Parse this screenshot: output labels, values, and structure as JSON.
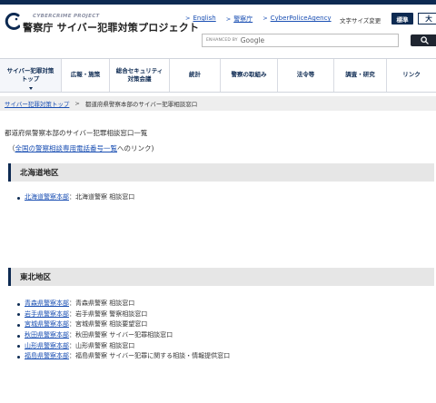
{
  "header": {
    "logo_sub": "CYBERCRIME PROJECT",
    "logo_main": "警察庁 サイバー犯罪対策プロジェクト",
    "top_links": [
      "English",
      "警察庁",
      "CyberPoliceAgency"
    ],
    "font_size_label": "文字サイズ変更",
    "font_std": "標準",
    "font_large": "大",
    "search_enhanced": "ENHANCED BY",
    "search_google": "Google"
  },
  "nav": [
    "サイバー犯罪対策\nトップ",
    "広報・施策",
    "総合セキュリティ\n対策会議",
    "統計",
    "警察の取組み",
    "法令等",
    "調査・研究",
    "リンク"
  ],
  "breadcrumb": {
    "home": "サイバー犯罪対策トップ",
    "sep": ">",
    "current": "都道府県警察本部のサイバー犯罪相談窓口"
  },
  "main": {
    "heading": "都道府県警察本部のサイバー犯罪相談窓口一覧",
    "national_prefix": "（",
    "national_link": "全国の警察相談専用電話番号一覧",
    "national_suffix": "へのリンク)"
  },
  "regions": [
    {
      "name": "北海道地区",
      "items": [
        {
          "link": "北海道警察本部",
          "desc": "：北海道警察 相談窓口"
        }
      ]
    },
    {
      "name": "東北地区",
      "items": [
        {
          "link": "青森県警察本部",
          "desc": "：青森県警察 相談窓口"
        },
        {
          "link": "岩手県警察本部",
          "desc": "：岩手県警察 警察相談窓口"
        },
        {
          "link": "宮城県警察本部",
          "desc": "：宮城県警察 相談要望窓口"
        },
        {
          "link": "秋田県警察本部",
          "desc": "：秋田県警察 サイバー犯罪相談窓口"
        },
        {
          "link": "山形県警察本部",
          "desc": "：山形県警察 相談窓口"
        },
        {
          "link": "福島県警察本部",
          "desc": "：福島県警察 サイバー犯罪に関する相談・情報提供窓口"
        }
      ]
    }
  ],
  "colors": {
    "navy": "#0d2a52",
    "link": "#1a4fb3",
    "band": "#e6e6e6"
  }
}
